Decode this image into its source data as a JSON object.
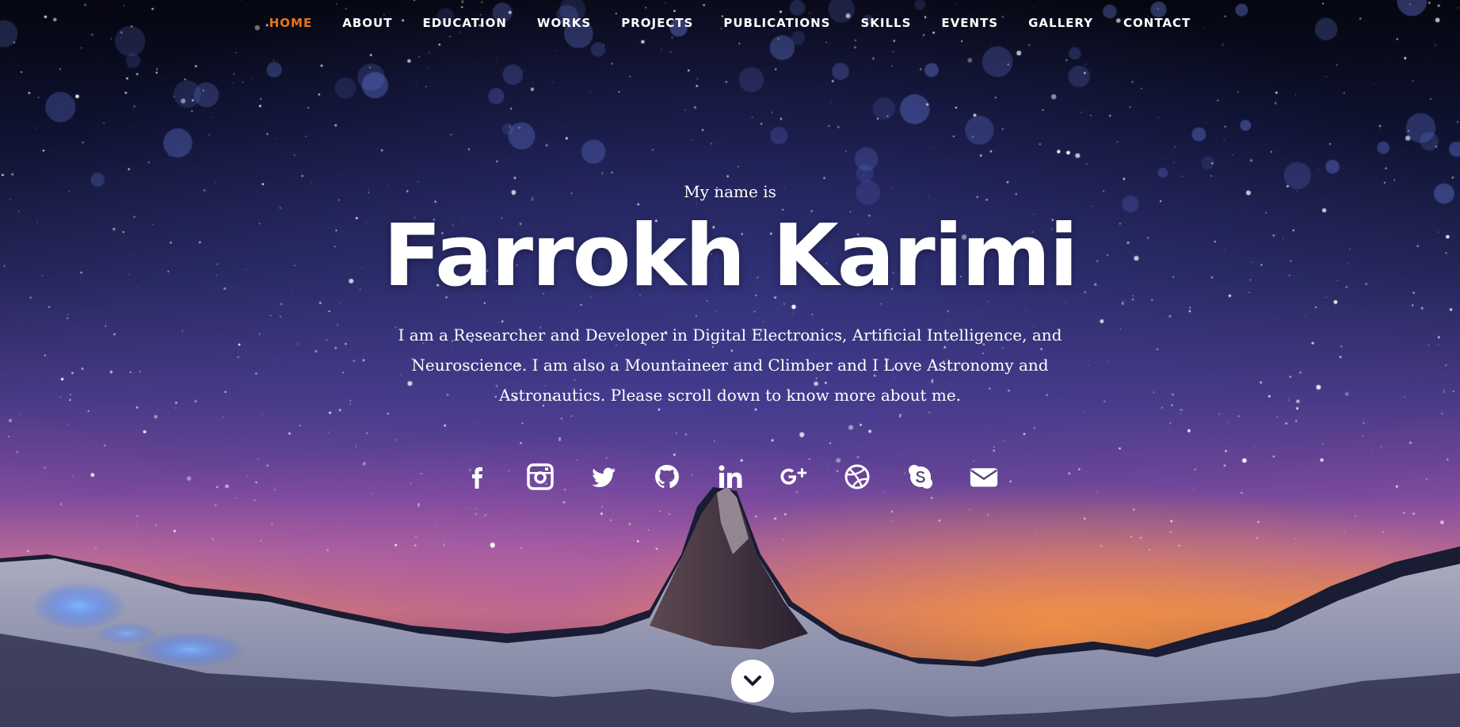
{
  "nav": {
    "items": [
      {
        "label": "HOME",
        "active": true
      },
      {
        "label": "ABOUT"
      },
      {
        "label": "EDUCATION"
      },
      {
        "label": "WORKS"
      },
      {
        "label": "PROJECTS"
      },
      {
        "label": "PUBLICATIONS"
      },
      {
        "label": "SKILLS"
      },
      {
        "label": "EVENTS"
      },
      {
        "label": "GALLERY"
      },
      {
        "label": "CONTACT"
      }
    ]
  },
  "hero": {
    "intro": "My name is",
    "name": "Farrokh Karimi",
    "bio": "I am a Researcher and Developer in Digital Electronics, Artificial Intelligence, and Neuroscience. I am also a Mountaineer and Climber and I Love Astronomy and Astronautics. Please scroll down to know more about me."
  },
  "social": [
    {
      "icon": "facebook-icon"
    },
    {
      "icon": "instagram-icon"
    },
    {
      "icon": "twitter-icon"
    },
    {
      "icon": "github-icon"
    },
    {
      "icon": "linkedin-icon"
    },
    {
      "icon": "google-plus-icon"
    },
    {
      "icon": "dribbble-icon"
    },
    {
      "icon": "skype-icon"
    },
    {
      "icon": "envelope-icon"
    }
  ],
  "scroll_button": {
    "icon": "chevron-down-icon"
  },
  "colors": {
    "nav_active": "#e8751a",
    "text": "#ffffff"
  }
}
